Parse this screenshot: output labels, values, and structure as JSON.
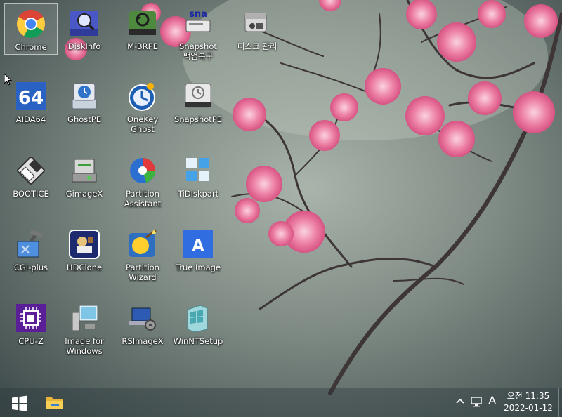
{
  "desktop": {
    "icons": [
      {
        "label": "Chrome",
        "icon": "chrome-icon"
      },
      {
        "label": "DiskInfo",
        "icon": "diskinfo-icon"
      },
      {
        "label": "M-BRPE",
        "icon": "m-brpe-icon"
      },
      {
        "label": "Snapshot\n백업복구",
        "icon": "snapshot-backup-icon"
      },
      {
        "label": "디스크 관리",
        "icon": "disk-management-icon"
      },
      {
        "label": "AIDA64",
        "icon": "aida64-icon"
      },
      {
        "label": "GhostPE",
        "icon": "ghostpe-icon"
      },
      {
        "label": "OneKey Ghost",
        "icon": "onekey-ghost-icon"
      },
      {
        "label": "SnapshotPE",
        "icon": "snapshotpe-icon"
      },
      {
        "label": "BOOTICE",
        "icon": "bootice-icon"
      },
      {
        "label": "GimageX",
        "icon": "gimagex-icon"
      },
      {
        "label": "Partition\nAssistant",
        "icon": "partition-assistant-icon"
      },
      {
        "label": "TiDiskpart",
        "icon": "tidiskpart-icon"
      },
      {
        "label": "CGI-plus",
        "icon": "cgi-plus-icon"
      },
      {
        "label": "HDClone",
        "icon": "hdclone-icon"
      },
      {
        "label": "Partition\nWizard",
        "icon": "partition-wizard-icon"
      },
      {
        "label": "True Image",
        "icon": "true-image-icon"
      },
      {
        "label": "CPU-Z",
        "icon": "cpu-z-icon"
      },
      {
        "label": "Image for\nWindows",
        "icon": "image-for-windows-icon"
      },
      {
        "label": "RSImageX",
        "icon": "rsimagex-icon"
      },
      {
        "label": "WinNTSetup",
        "icon": "winntsetup-icon"
      }
    ],
    "aida_badge": "64",
    "snapshot_badge": "sna",
    "true_image_badge": "A"
  },
  "taskbar": {
    "start": "start-icon",
    "explorer": "file-explorer-icon",
    "tray_chevron": "^",
    "tray_network": "network-icon",
    "ime": "A",
    "time": "오전 11:35",
    "date": "2022-01-12"
  }
}
